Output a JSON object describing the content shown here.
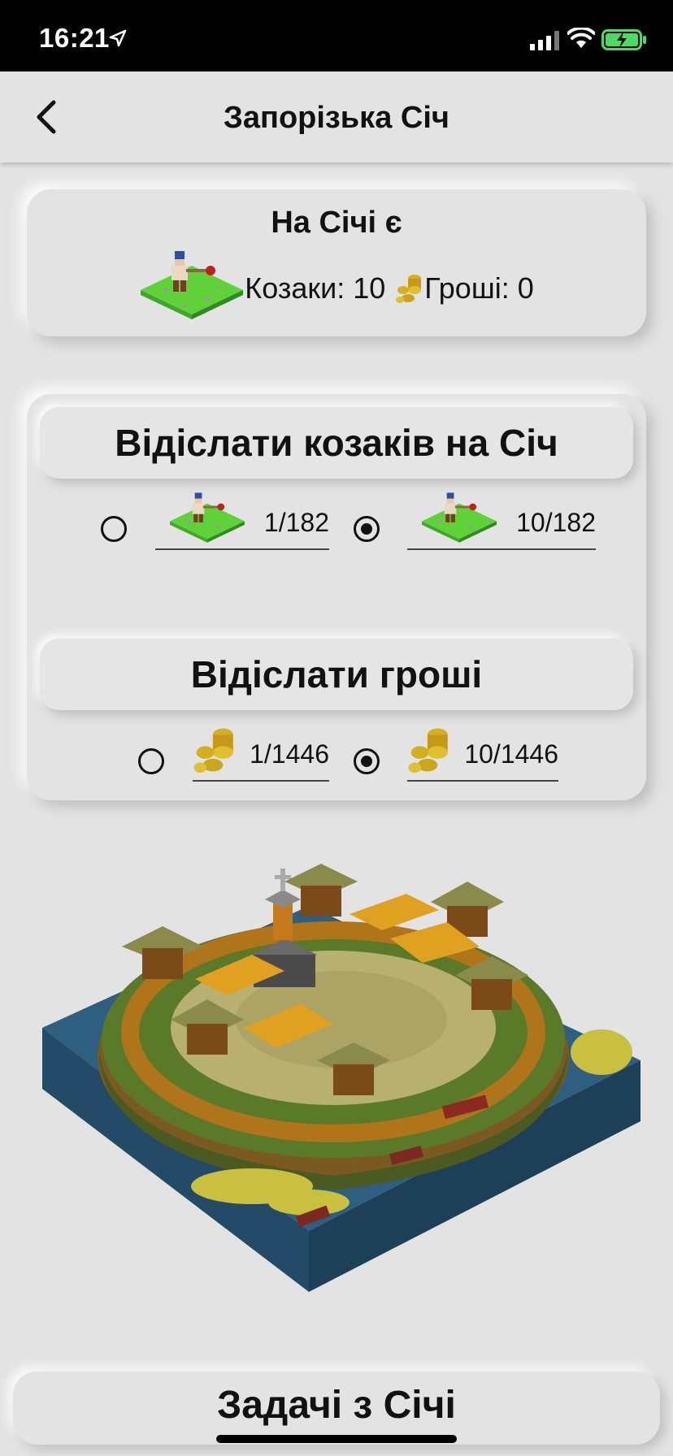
{
  "status": {
    "time": "16:21"
  },
  "nav": {
    "title": "Запорізька Січ"
  },
  "info": {
    "title": "На Січі є",
    "cossacks_label": "Козаки: 10",
    "money_label": "Гроші: 0"
  },
  "send_cossacks": {
    "title": "Відіслати козаків на Січ",
    "options": [
      {
        "label": "1/182",
        "selected": false
      },
      {
        "label": "10/182",
        "selected": true
      }
    ]
  },
  "send_money": {
    "title": "Відіслати гроші",
    "options": [
      {
        "label": "1/1446",
        "selected": false
      },
      {
        "label": "10/1446",
        "selected": true
      }
    ]
  },
  "tasks": {
    "label": "Задачі з Січі"
  },
  "icons": {
    "back": "chevron-left-icon",
    "cossack": "cossack-tile-icon",
    "coins": "coins-icon",
    "location": "location-arrow-icon",
    "signal": "cellular-signal-icon",
    "wifi": "wifi-icon",
    "battery": "battery-charging-icon"
  },
  "colors": {
    "background": "#e3e3e3",
    "grass": "#5fd23a",
    "water": "#2f5f80",
    "coin": "#d4b020",
    "battery": "#4cd964"
  }
}
